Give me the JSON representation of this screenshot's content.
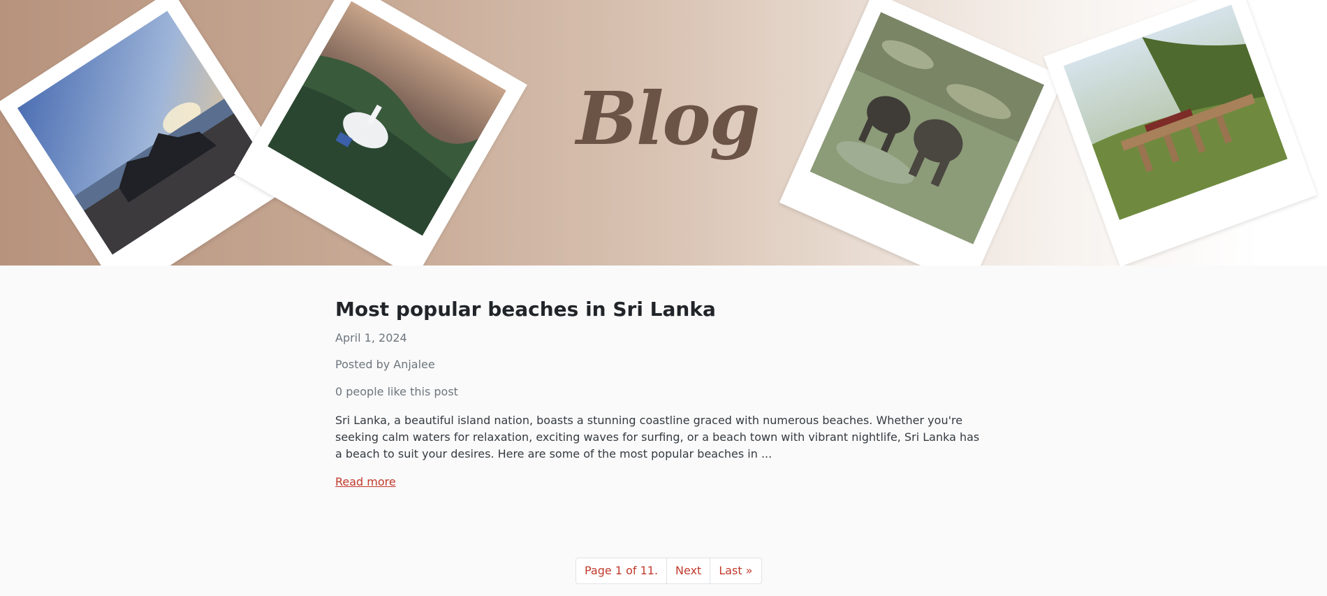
{
  "hero": {
    "title": "Blog",
    "photos": [
      {
        "icon": "beach-sunset-photo"
      },
      {
        "icon": "hilltop-temple-photo"
      },
      {
        "icon": "elephants-river-photo"
      },
      {
        "icon": "arch-bridge-train-photo"
      }
    ]
  },
  "post": {
    "title": "Most popular beaches in Sri Lanka",
    "date": "April 1, 2024",
    "author": "Posted by Anjalee",
    "likes": "0 people like this post",
    "excerpt": "Sri Lanka, a beautiful island nation, boasts a stunning coastline graced with numerous beaches. Whether you're seeking calm waters for relaxation, exciting waves for surfing, or a beach town with vibrant nightlife, Sri Lanka has a beach to suit your desires. Here are some of the most popular beaches in ...",
    "read_more": "Read more"
  },
  "pagination": {
    "status": "Page 1 of 11.",
    "next": "Next",
    "last": "Last »"
  },
  "colors": {
    "accent": "#c0392b",
    "title": "#6b5346",
    "text": "#212529",
    "muted": "#6c757d"
  }
}
